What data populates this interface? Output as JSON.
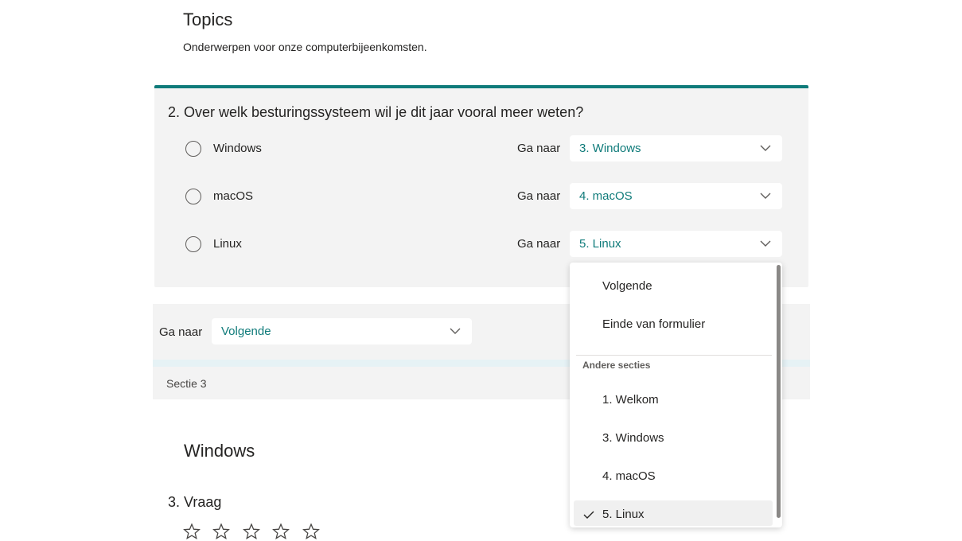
{
  "section1": {
    "title": "Topics",
    "description": "Onderwerpen voor onze computerbijeenkomsten."
  },
  "question2": {
    "title": "2. Over welk besturingssysteem wil je dit jaar vooral meer weten?",
    "options": [
      {
        "label": "Windows",
        "goto_label": "Ga naar",
        "goto_value": "3. Windows"
      },
      {
        "label": "macOS",
        "goto_label": "Ga naar",
        "goto_value": "4. macOS"
      },
      {
        "label": "Linux",
        "goto_label": "Ga naar",
        "goto_value": "5. Linux"
      }
    ]
  },
  "branching": {
    "goto_label": "Ga naar",
    "goto_value": "Volgende"
  },
  "section_label": "Sectie 3",
  "section3": {
    "title": "Windows",
    "question": "3. Vraag",
    "rating_max": 5
  },
  "dropdown": {
    "items": [
      "Volgende",
      "Einde van formulier"
    ],
    "group_label": "Andere secties",
    "sections": [
      "1. Welkom",
      "3. Windows",
      "4. macOS",
      "5. Linux"
    ],
    "selected": "5. Linux"
  },
  "colors": {
    "accent": "#0f7b7a",
    "card_bg": "#f3f3f3"
  }
}
